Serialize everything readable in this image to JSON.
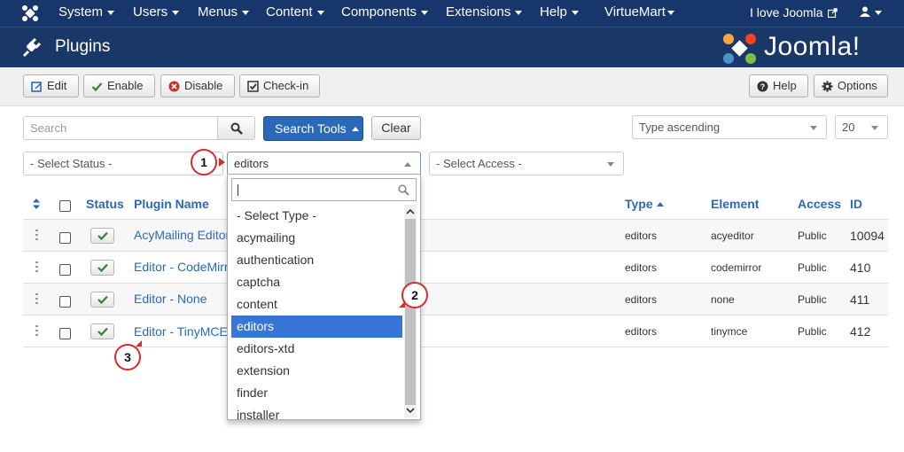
{
  "topnav": {
    "items": [
      "System",
      "Users",
      "Menus",
      "Content",
      "Components",
      "Extensions",
      "Help",
      "VirtueMart"
    ],
    "site_link": "I love Joomla"
  },
  "header": {
    "title": "Plugins",
    "brand": "Joomla!"
  },
  "toolbar": {
    "edit": "Edit",
    "enable": "Enable",
    "disable": "Disable",
    "checkin": "Check-in",
    "help": "Help",
    "options": "Options"
  },
  "filters": {
    "search_placeholder": "Search",
    "search_tools": "Search Tools",
    "clear": "Clear",
    "sort": "Type ascending",
    "limit": "20",
    "status": "- Select Status -",
    "type_selected": "editors",
    "access": "- Select Access -"
  },
  "table": {
    "headers": {
      "status": "Status",
      "name": "Plugin Name",
      "type": "Type",
      "element": "Element",
      "access": "Access",
      "id": "ID"
    },
    "rows": [
      {
        "name": "AcyMailing Editor",
        "type": "editors",
        "element": "acyeditor",
        "access": "Public",
        "id": "10094"
      },
      {
        "name": "Editor - CodeMirror",
        "type": "editors",
        "element": "codemirror",
        "access": "Public",
        "id": "410"
      },
      {
        "name": "Editor - None",
        "type": "editors",
        "element": "none",
        "access": "Public",
        "id": "411"
      },
      {
        "name": "Editor - TinyMCE",
        "type": "editors",
        "element": "tinymce",
        "access": "Public",
        "id": "412"
      }
    ]
  },
  "type_dropdown": {
    "options": [
      "- Select Type -",
      "acymailing",
      "authentication",
      "captcha",
      "content",
      "editors",
      "editors-xtd",
      "extension",
      "finder",
      "installer"
    ],
    "highlighted_index": 5
  },
  "callouts": [
    "1",
    "2",
    "3"
  ],
  "colors": {
    "navbar": "#17366b",
    "primary": "#2a69b8",
    "callout": "#d92b2b",
    "highlight": "#3875d7"
  }
}
